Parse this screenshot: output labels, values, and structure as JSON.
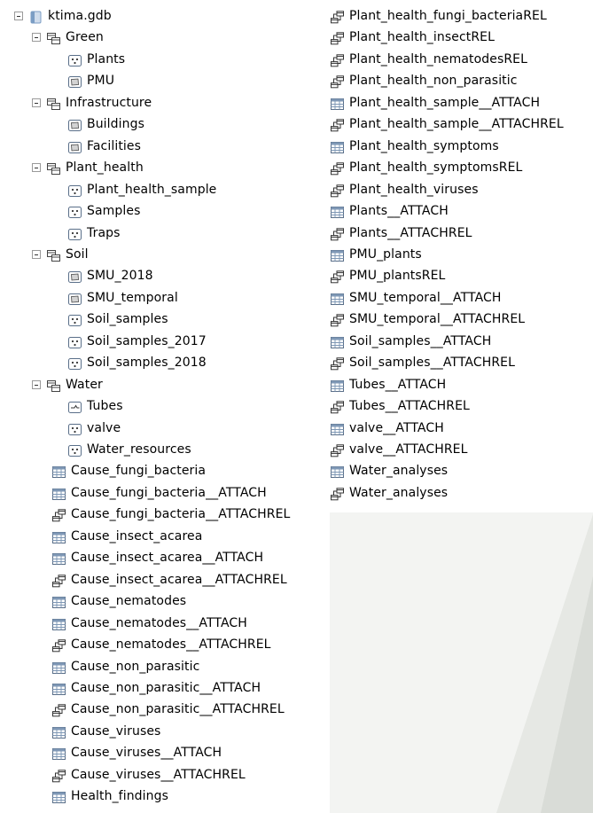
{
  "colors": {
    "page_bg": "#f3f4f2",
    "panel_bg": "#ffffff",
    "icon_border": "#5a6f89",
    "table_header": "#7f98b6",
    "db_icon": "#7b9dc4"
  },
  "tree": {
    "root": {
      "label": "ktima.gdb",
      "icon": "database-icon"
    },
    "datasets": [
      {
        "label": "Green",
        "icon": "feature-dataset-icon",
        "children": [
          {
            "label": "Plants",
            "icon": "point-feature-class-icon"
          },
          {
            "label": "PMU",
            "icon": "polygon-feature-class-icon"
          }
        ]
      },
      {
        "label": "Infrastructure",
        "icon": "feature-dataset-icon",
        "children": [
          {
            "label": "Buildings",
            "icon": "polygon-feature-class-icon"
          },
          {
            "label": "Facilities",
            "icon": "polygon-feature-class-icon"
          }
        ]
      },
      {
        "label": "Plant_health",
        "icon": "feature-dataset-icon",
        "children": [
          {
            "label": "Plant_health_sample",
            "icon": "point-feature-class-icon"
          },
          {
            "label": "Samples",
            "icon": "point-feature-class-icon"
          },
          {
            "label": "Traps",
            "icon": "point-feature-class-icon"
          }
        ]
      },
      {
        "label": "Soil",
        "icon": "feature-dataset-icon",
        "children": [
          {
            "label": "SMU_2018",
            "icon": "polygon-feature-class-icon"
          },
          {
            "label": "SMU_temporal",
            "icon": "polygon-feature-class-icon"
          },
          {
            "label": "Soil_samples",
            "icon": "point-feature-class-icon"
          },
          {
            "label": "Soil_samples_2017",
            "icon": "point-feature-class-icon"
          },
          {
            "label": "Soil_samples_2018",
            "icon": "point-feature-class-icon"
          }
        ]
      },
      {
        "label": "Water",
        "icon": "feature-dataset-icon",
        "children": [
          {
            "label": "Tubes",
            "icon": "line-feature-class-icon"
          },
          {
            "label": "valve",
            "icon": "point-feature-class-icon"
          },
          {
            "label": "Water_resources",
            "icon": "point-feature-class-icon"
          }
        ]
      }
    ],
    "left_items": [
      {
        "label": "Cause_fungi_bacteria",
        "icon": "table-icon"
      },
      {
        "label": "Cause_fungi_bacteria__ATTACH",
        "icon": "table-icon"
      },
      {
        "label": "Cause_fungi_bacteria__ATTACHREL",
        "icon": "relationship-class-icon"
      },
      {
        "label": "Cause_insect_acarea",
        "icon": "table-icon"
      },
      {
        "label": "Cause_insect_acarea__ATTACH",
        "icon": "table-icon"
      },
      {
        "label": "Cause_insect_acarea__ATTACHREL",
        "icon": "relationship-class-icon"
      },
      {
        "label": "Cause_nematodes",
        "icon": "table-icon"
      },
      {
        "label": "Cause_nematodes__ATTACH",
        "icon": "table-icon"
      },
      {
        "label": "Cause_nematodes__ATTACHREL",
        "icon": "relationship-class-icon"
      },
      {
        "label": "Cause_non_parasitic",
        "icon": "table-icon"
      },
      {
        "label": "Cause_non_parasitic__ATTACH",
        "icon": "table-icon"
      },
      {
        "label": "Cause_non_parasitic__ATTACHREL",
        "icon": "relationship-class-icon"
      },
      {
        "label": "Cause_viruses",
        "icon": "table-icon"
      },
      {
        "label": "Cause_viruses__ATTACH",
        "icon": "table-icon"
      },
      {
        "label": "Cause_viruses__ATTACHREL",
        "icon": "relationship-class-icon"
      },
      {
        "label": "Health_findings",
        "icon": "table-icon"
      }
    ],
    "right_items": [
      {
        "label": "Plant_health_fungi_bacteriaREL",
        "icon": "relationship-class-icon"
      },
      {
        "label": "Plant_health_insectREL",
        "icon": "relationship-class-icon"
      },
      {
        "label": "Plant_health_nematodesREL",
        "icon": "relationship-class-icon"
      },
      {
        "label": "Plant_health_non_parasitic",
        "icon": "relationship-class-icon"
      },
      {
        "label": "Plant_health_sample__ATTACH",
        "icon": "table-icon"
      },
      {
        "label": "Plant_health_sample__ATTACHREL",
        "icon": "relationship-class-icon"
      },
      {
        "label": "Plant_health_symptoms",
        "icon": "table-icon"
      },
      {
        "label": "Plant_health_symptomsREL",
        "icon": "relationship-class-icon"
      },
      {
        "label": "Plant_health_viruses",
        "icon": "relationship-class-icon"
      },
      {
        "label": "Plants__ATTACH",
        "icon": "table-icon"
      },
      {
        "label": "Plants__ATTACHREL",
        "icon": "relationship-class-icon"
      },
      {
        "label": "PMU_plants",
        "icon": "table-icon"
      },
      {
        "label": "PMU_plantsREL",
        "icon": "relationship-class-icon"
      },
      {
        "label": "SMU_temporal__ATTACH",
        "icon": "table-icon"
      },
      {
        "label": "SMU_temporal__ATTACHREL",
        "icon": "relationship-class-icon"
      },
      {
        "label": "Soil_samples__ATTACH",
        "icon": "table-icon"
      },
      {
        "label": "Soil_samples__ATTACHREL",
        "icon": "relationship-class-icon"
      },
      {
        "label": "Tubes__ATTACH",
        "icon": "table-icon"
      },
      {
        "label": "Tubes__ATTACHREL",
        "icon": "relationship-class-icon"
      },
      {
        "label": "valve__ATTACH",
        "icon": "table-icon"
      },
      {
        "label": "valve__ATTACHREL",
        "icon": "relationship-class-icon"
      },
      {
        "label": "Water_analyses",
        "icon": "table-icon"
      },
      {
        "label": "Water_analyses",
        "icon": "relationship-class-icon"
      }
    ]
  }
}
